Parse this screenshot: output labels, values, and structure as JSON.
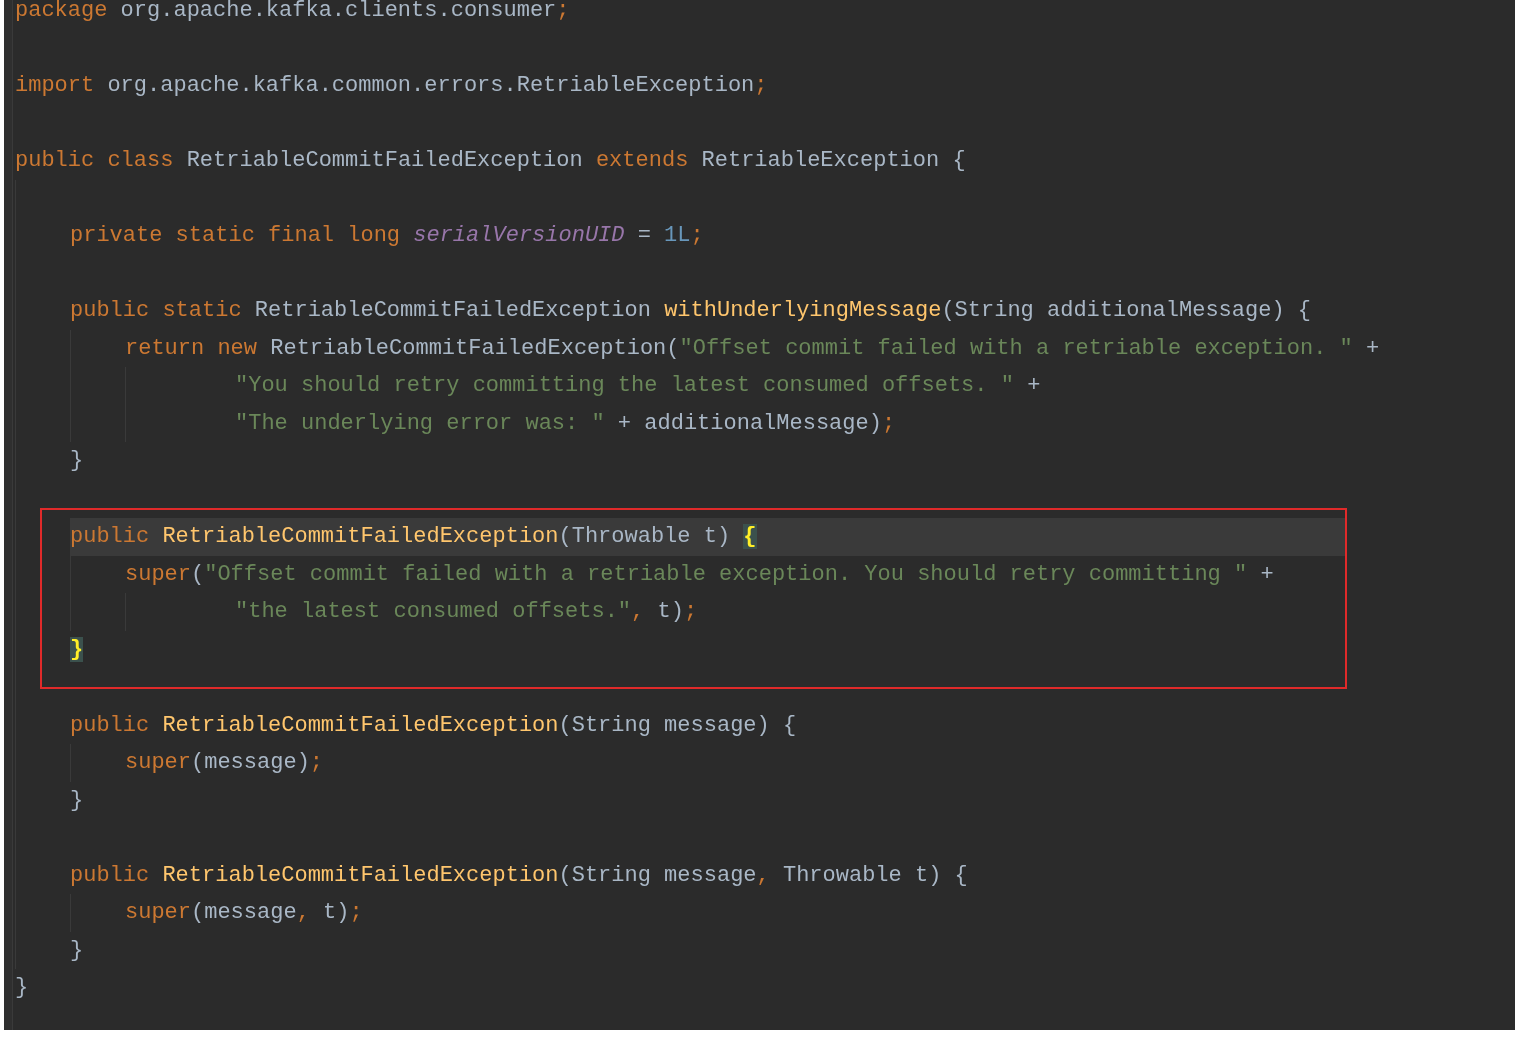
{
  "editor": {
    "lines": [
      {
        "kind": "line",
        "tokens": [
          {
            "kind": "keyword",
            "text": "package"
          },
          {
            "kind": "plain",
            "text": " org.apache.kafka.clients.consumer"
          },
          {
            "kind": "keyword",
            "text": ";"
          }
        ]
      },
      {
        "kind": "blank"
      },
      {
        "kind": "line",
        "tokens": [
          {
            "kind": "keyword",
            "text": "import"
          },
          {
            "kind": "plain",
            "text": " org.apache.kafka.common.errors.RetriableException"
          },
          {
            "kind": "keyword",
            "text": ";"
          }
        ]
      },
      {
        "kind": "blank"
      },
      {
        "kind": "block",
        "tokens": [
          {
            "kind": "keyword",
            "text": "public class "
          },
          {
            "kind": "plain",
            "text": "RetriableCommitFailedException "
          },
          {
            "kind": "keyword",
            "text": "extends "
          },
          {
            "kind": "plain",
            "text": "RetriableException {"
          }
        ],
        "children": [
          {
            "kind": "blank"
          },
          {
            "kind": "line",
            "tokens": [
              {
                "kind": "keyword",
                "text": "private static final long "
              },
              {
                "kind": "field",
                "text": "serialVersionUID"
              },
              {
                "kind": "plain",
                "text": " = "
              },
              {
                "kind": "number",
                "text": "1L"
              },
              {
                "kind": "keyword",
                "text": ";"
              }
            ]
          },
          {
            "kind": "blank"
          },
          {
            "kind": "block",
            "tokens": [
              {
                "kind": "keyword",
                "text": "public static "
              },
              {
                "kind": "plain",
                "text": "RetriableCommitFailedException "
              },
              {
                "kind": "method",
                "text": "withUnderlyingMessage"
              },
              {
                "kind": "plain",
                "text": "(String additionalMessage) {"
              }
            ],
            "children": [
              {
                "kind": "statement",
                "tokens": [
                  {
                    "kind": "keyword",
                    "text": "return new "
                  },
                  {
                    "kind": "plain",
                    "text": "RetriableCommitFailedException("
                  },
                  {
                    "kind": "string",
                    "text": "\"Offset commit failed with a retriable exception. \""
                  },
                  {
                    "kind": "plain",
                    "text": " +"
                  }
                ],
                "children": [
                  {
                    "kind": "line",
                    "tokens": [
                      {
                        "kind": "string",
                        "text": "\"You should retry committing the latest consumed offsets. \""
                      },
                      {
                        "kind": "plain",
                        "text": " +"
                      }
                    ]
                  },
                  {
                    "kind": "line",
                    "tokens": [
                      {
                        "kind": "string",
                        "text": "\"The underlying error was: \""
                      },
                      {
                        "kind": "plain",
                        "text": " + additionalMessage)"
                      },
                      {
                        "kind": "keyword",
                        "text": ";"
                      }
                    ]
                  }
                ]
              }
            ]
          },
          {
            "kind": "line",
            "tokens": [
              {
                "kind": "plain",
                "text": "}"
              }
            ]
          },
          {
            "kind": "blank"
          },
          {
            "kind": "boxed",
            "lines": [
              {
                "kind": "block",
                "current": true,
                "tokens": [
                  {
                    "kind": "keyword",
                    "text": "public "
                  },
                  {
                    "kind": "method",
                    "text": "RetriableCommitFailedException"
                  },
                  {
                    "kind": "plain",
                    "text": "(Throwable t) "
                  },
                  {
                    "kind": "brace",
                    "text": "{"
                  }
                ],
                "children": [
                  {
                    "kind": "statement",
                    "tokens": [
                      {
                        "kind": "keyword",
                        "text": "super"
                      },
                      {
                        "kind": "plain",
                        "text": "("
                      },
                      {
                        "kind": "string",
                        "text": "\"Offset commit failed with a retriable exception. You should retry committing \""
                      },
                      {
                        "kind": "plain",
                        "text": " +"
                      }
                    ],
                    "children": [
                      {
                        "kind": "line",
                        "tokens": [
                          {
                            "kind": "string",
                            "text": "\"the latest consumed offsets.\""
                          },
                          {
                            "kind": "keyword",
                            "text": ", "
                          },
                          {
                            "kind": "plain",
                            "text": "t)"
                          },
                          {
                            "kind": "keyword",
                            "text": ";"
                          }
                        ]
                      }
                    ]
                  }
                ]
              },
              {
                "kind": "line",
                "current": false,
                "tokens": [
                  {
                    "kind": "brace",
                    "text": "}"
                  }
                ]
              }
            ]
          },
          {
            "kind": "blank"
          },
          {
            "kind": "block",
            "tokens": [
              {
                "kind": "keyword",
                "text": "public "
              },
              {
                "kind": "method",
                "text": "RetriableCommitFailedException"
              },
              {
                "kind": "plain",
                "text": "(String message) {"
              }
            ],
            "children": [
              {
                "kind": "line",
                "tokens": [
                  {
                    "kind": "keyword",
                    "text": "super"
                  },
                  {
                    "kind": "plain",
                    "text": "(message)"
                  },
                  {
                    "kind": "keyword",
                    "text": ";"
                  }
                ]
              }
            ]
          },
          {
            "kind": "line",
            "tokens": [
              {
                "kind": "plain",
                "text": "}"
              }
            ]
          },
          {
            "kind": "blank"
          },
          {
            "kind": "block",
            "tokens": [
              {
                "kind": "keyword",
                "text": "public "
              },
              {
                "kind": "method",
                "text": "RetriableCommitFailedException"
              },
              {
                "kind": "plain",
                "text": "(String message"
              },
              {
                "kind": "keyword",
                "text": ", "
              },
              {
                "kind": "plain",
                "text": "Throwable t) {"
              }
            ],
            "children": [
              {
                "kind": "line",
                "tokens": [
                  {
                    "kind": "keyword",
                    "text": "super"
                  },
                  {
                    "kind": "plain",
                    "text": "(message"
                  },
                  {
                    "kind": "keyword",
                    "text": ", "
                  },
                  {
                    "kind": "plain",
                    "text": "t)"
                  },
                  {
                    "kind": "keyword",
                    "text": ";"
                  }
                ]
              }
            ]
          },
          {
            "kind": "line",
            "tokens": [
              {
                "kind": "plain",
                "text": "}"
              }
            ]
          }
        ]
      },
      {
        "kind": "line",
        "tokens": [
          {
            "kind": "plain",
            "text": "}"
          }
        ]
      }
    ]
  }
}
